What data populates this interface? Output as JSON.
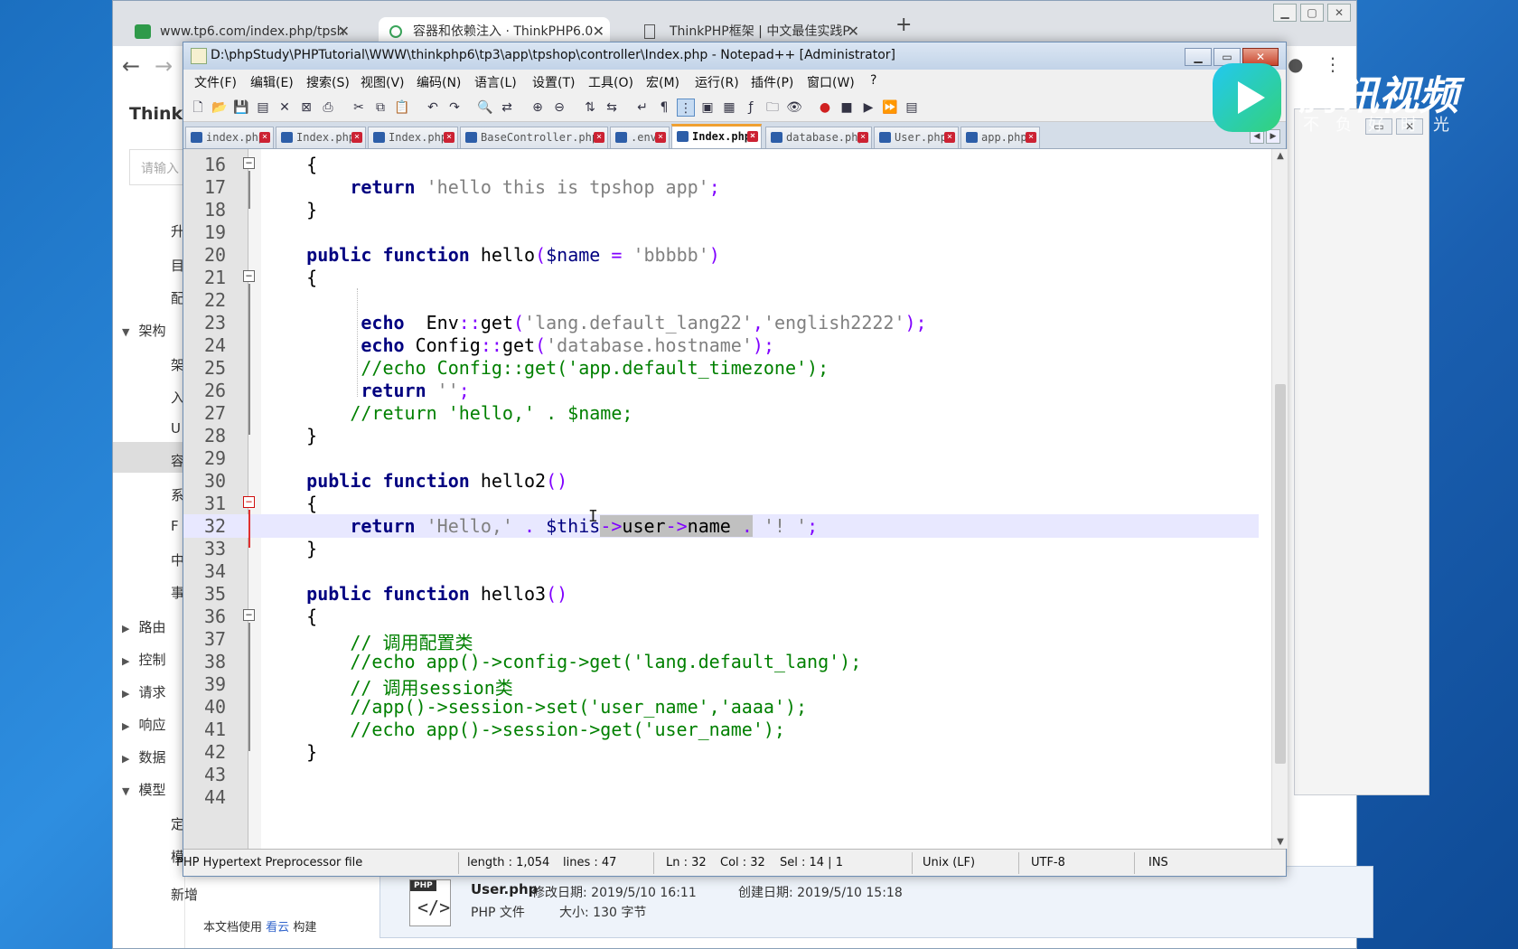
{
  "browser": {
    "tabs": [
      {
        "label": "www.tp6.com/index.php/tpsh",
        "close": "✕"
      },
      {
        "label": "容器和依赖注入 · ThinkPHP6.0",
        "close": "✕"
      },
      {
        "label": "ThinkPHP框架 | 中文最佳实践P",
        "close": "✕"
      }
    ],
    "new_tab": "+"
  },
  "doc": {
    "brand": "ThinkP",
    "search_placeholder": "请输入",
    "nav": [
      {
        "label": "升"
      },
      {
        "label": "目"
      },
      {
        "label": "配"
      },
      {
        "label": "架构",
        "caret": "▼"
      },
      {
        "label": "架"
      },
      {
        "label": "入"
      },
      {
        "label": "U"
      },
      {
        "label": "容"
      },
      {
        "label": "系"
      },
      {
        "label": "F"
      },
      {
        "label": "中"
      },
      {
        "label": "事"
      },
      {
        "label": "路由",
        "caret": "▶"
      },
      {
        "label": "控制",
        "caret": "▶"
      },
      {
        "label": "请求",
        "caret": "▶"
      },
      {
        "label": "响应",
        "caret": "▶"
      },
      {
        "label": "数据",
        "caret": "▶"
      },
      {
        "label": "模型",
        "caret": "▼"
      },
      {
        "label": "定"
      },
      {
        "label": "模"
      },
      {
        "label": "新增"
      }
    ],
    "footer_prefix": "本文档使用",
    "footer_link": "看云",
    "footer_suffix": "构建"
  },
  "explorer": {
    "file_name": "User.php",
    "modified_label": "修改日期: 2019/5/10 16:11",
    "created_label": "创建日期: 2019/5/10 15:18",
    "file_type": "PHP 文件",
    "size_label": "大小: 130 字节",
    "icon_tag": "PHP"
  },
  "npp": {
    "title": "D:\\phpStudy\\PHPTutorial\\WWW\\thinkphp6\\tp3\\app\\tpshop\\controller\\Index.php - Notepad++ [Administrator]",
    "menu": [
      "文件(F)",
      "编辑(E)",
      "搜索(S)",
      "视图(V)",
      "编码(N)",
      "语言(L)",
      "设置(T)",
      "工具(O)",
      "宏(M)",
      "运行(R)",
      "插件(P)",
      "窗口(W)",
      "?"
    ],
    "file_tabs": [
      {
        "label": "index.php"
      },
      {
        "label": "Index.php"
      },
      {
        "label": "Index.php"
      },
      {
        "label": "BaseController.php"
      },
      {
        "label": ".env"
      },
      {
        "label": "Index.php",
        "active": true
      },
      {
        "label": "database.php"
      },
      {
        "label": "User.php"
      },
      {
        "label": "app.php"
      }
    ],
    "status": {
      "file_type": "PHP Hypertext Preprocessor file",
      "length": "length : 1,054",
      "lines": "lines : 47",
      "ln": "Ln : 32",
      "col": "Col : 32",
      "sel": "Sel : 14 | 1",
      "eol": "Unix (LF)",
      "encoding": "UTF-8",
      "mode": "INS"
    }
  },
  "code_lines": [
    {
      "n": "16",
      "t": "    {"
    },
    {
      "n": "17",
      "t": "        return 'hello this is tpshop app';"
    },
    {
      "n": "18",
      "t": "    }"
    },
    {
      "n": "19",
      "t": ""
    },
    {
      "n": "20",
      "t": "    public function hello($name = 'bbbbb')"
    },
    {
      "n": "21",
      "t": "    {"
    },
    {
      "n": "22",
      "t": ""
    },
    {
      "n": "23",
      "t": "         echo  Env::get('lang.default_lang22','english2222');"
    },
    {
      "n": "24",
      "t": "         echo Config::get('database.hostname');"
    },
    {
      "n": "25",
      "t": "         //echo Config::get('app.default_timezone');"
    },
    {
      "n": "26",
      "t": "         return '';"
    },
    {
      "n": "27",
      "t": "        //return 'hello,' . $name;"
    },
    {
      "n": "28",
      "t": "    }"
    },
    {
      "n": "29",
      "t": ""
    },
    {
      "n": "30",
      "t": "    public function hello2()"
    },
    {
      "n": "31",
      "t": "    {"
    },
    {
      "n": "32",
      "t": "        return 'Hello,' . $this->user->name . '! ';"
    },
    {
      "n": "33",
      "t": "    }"
    },
    {
      "n": "34",
      "t": ""
    },
    {
      "n": "35",
      "t": "    public function hello3()"
    },
    {
      "n": "36",
      "t": "    {"
    },
    {
      "n": "37",
      "t": "        // 调用配置类"
    },
    {
      "n": "38",
      "t": "        //echo app()->config->get('lang.default_lang');"
    },
    {
      "n": "39",
      "t": "        // 调用session类"
    },
    {
      "n": "40",
      "t": "        //app()->session->set('user_name','aaaa');"
    },
    {
      "n": "41",
      "t": "        //echo app()->session->get('user_name');"
    },
    {
      "n": "42",
      "t": "    }"
    },
    {
      "n": "43",
      "t": ""
    },
    {
      "n": "44",
      "t": ""
    }
  ],
  "watermark": {
    "name": "腾讯视频",
    "slogan": "不负好时光"
  },
  "colors": {
    "keyword": "#000080",
    "string": "#808080",
    "comment": "#008000",
    "operator": "#8000ff",
    "current_line": "#e8e8ff",
    "active_tab_accent": "#f0a030"
  }
}
